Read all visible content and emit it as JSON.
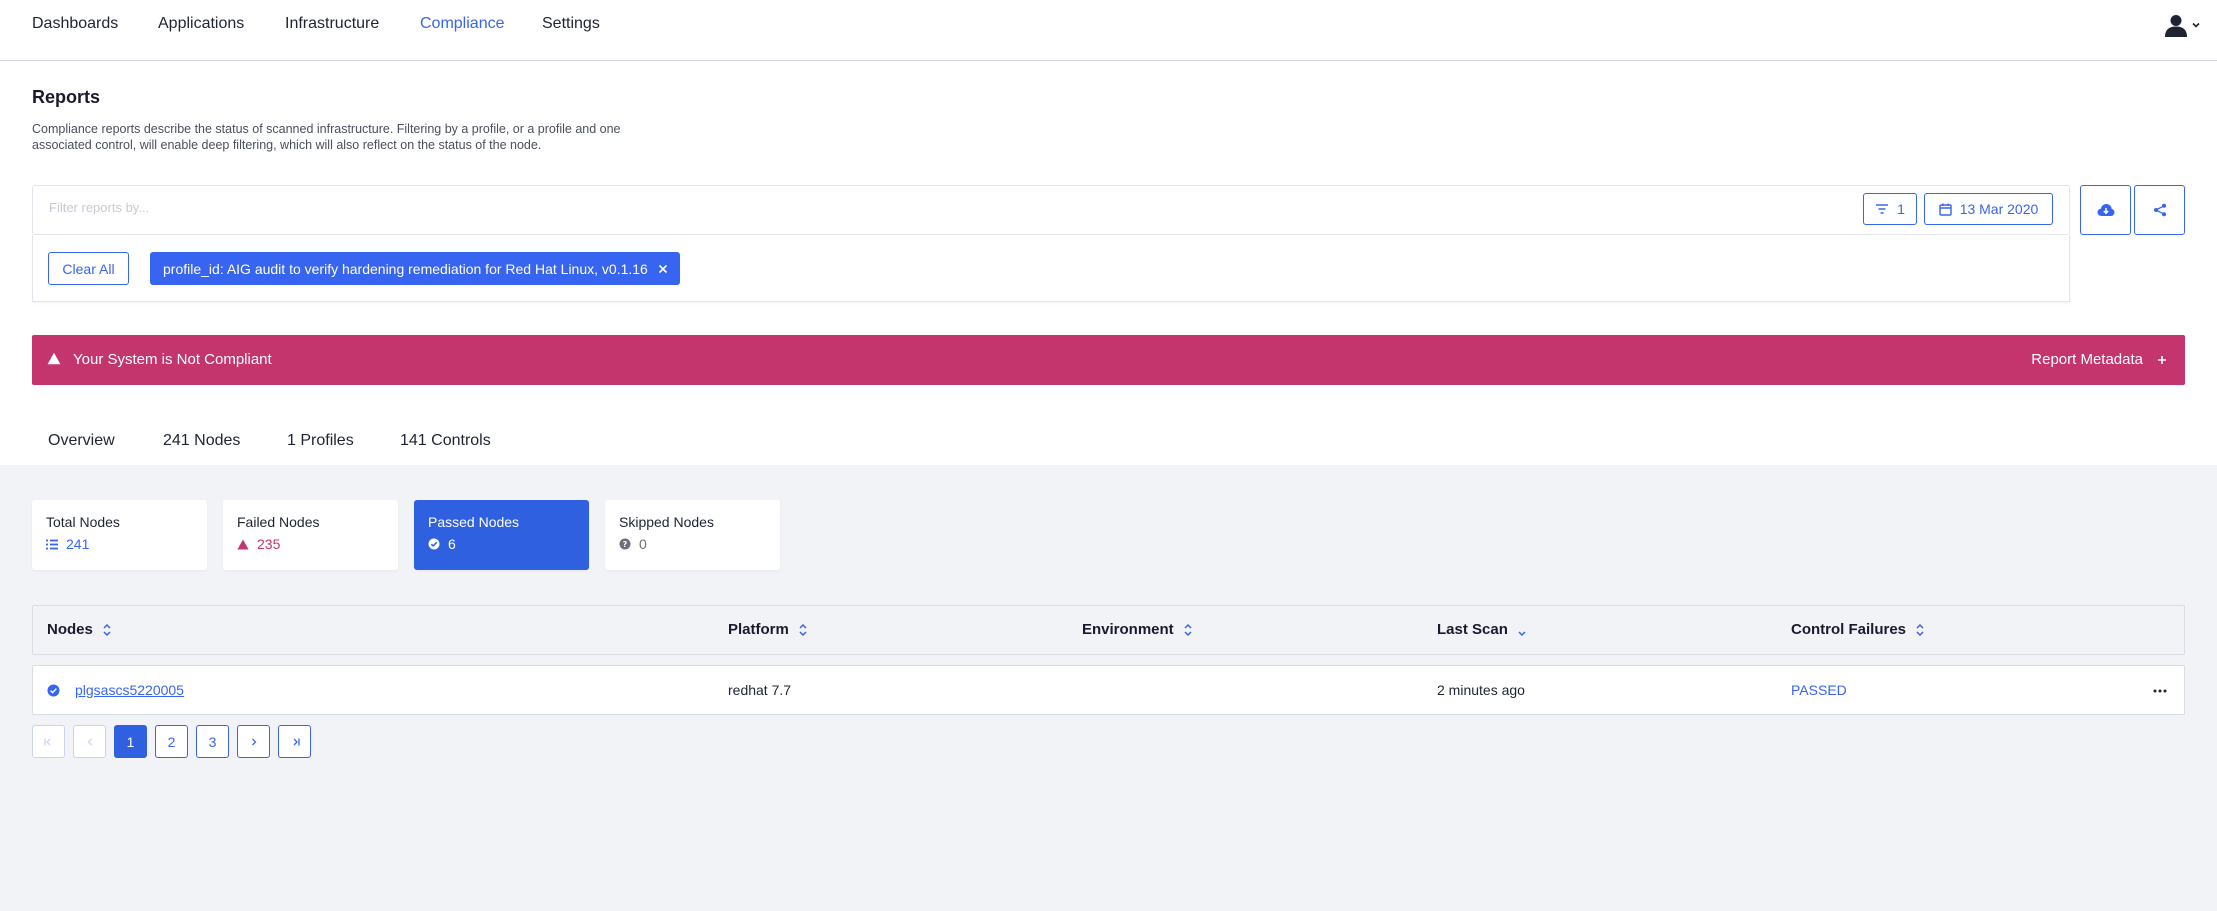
{
  "nav": {
    "items": [
      "Dashboards",
      "Applications",
      "Infrastructure",
      "Compliance",
      "Settings"
    ],
    "active": "Compliance"
  },
  "header": {
    "title": "Reports",
    "description": "Compliance reports describe the status of scanned infrastructure. Filtering by a profile, or a profile and one associated control, will enable deep filtering, which will also reflect on the status of the node."
  },
  "search": {
    "placeholder": "Filter reports by...",
    "filter_count": "1",
    "date": "13 Mar 2020"
  },
  "filters": {
    "clear_all_label": "Clear All",
    "active_filter": "profile_id: AIG audit to verify hardening remediation for Red Hat Linux, v0.1.16"
  },
  "banner": {
    "text": "Your System is Not Compliant",
    "meta_label": "Report Metadata",
    "color": "#c4346d"
  },
  "tabs": [
    "Overview",
    "241 Nodes",
    "1 Profiles",
    "141 Controls"
  ],
  "stats": [
    {
      "label": "Total Nodes",
      "value": "241",
      "icon": "list-icon",
      "color": "#3864f2"
    },
    {
      "label": "Failed Nodes",
      "value": "235",
      "icon": "warning-icon",
      "color": "#c4346d"
    },
    {
      "label": "Passed Nodes",
      "value": "6",
      "icon": "check-circle-icon",
      "color": "#ffffff"
    },
    {
      "label": "Skipped Nodes",
      "value": "0",
      "icon": "question-circle-icon",
      "color": "#6b6f7a"
    }
  ],
  "table": {
    "columns": [
      "Nodes",
      "Platform",
      "Environment",
      "Last Scan",
      "Control Failures"
    ],
    "rows": [
      {
        "node": "plgsascs5220005",
        "platform": "redhat 7.7",
        "environment": "",
        "last_scan": "2 minutes ago",
        "control_failures": "PASSED"
      }
    ]
  },
  "pagination": {
    "pages": [
      "1",
      "2",
      "3"
    ],
    "current": "1"
  },
  "colors": {
    "accent": "#3864f2",
    "danger": "#c4346d"
  }
}
